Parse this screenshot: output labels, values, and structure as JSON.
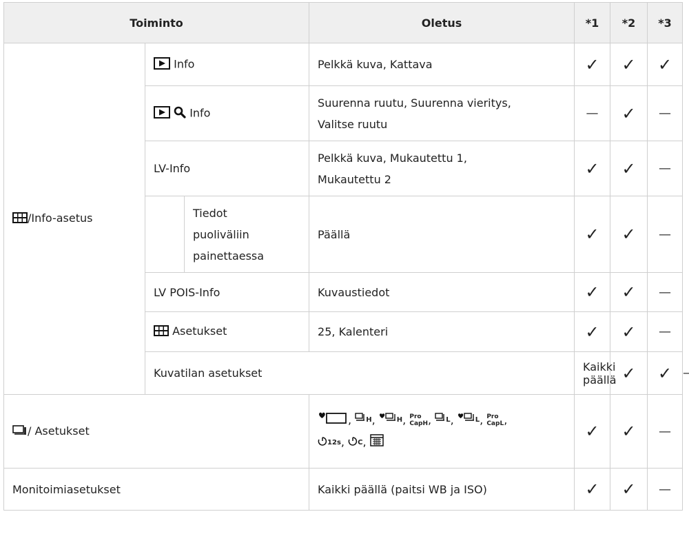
{
  "header": {
    "col_function": "Toiminto",
    "col_default": "Oletus",
    "col1": "*1",
    "col2": "*2",
    "col3": "*3"
  },
  "groups": {
    "info_setting": "/Info-asetus",
    "shooting_mode": "Kuvatilan asetukset",
    "drive_timer": "/ Asetukset",
    "multifunction": "Monitoimiasetukset"
  },
  "rows": {
    "play_info": {
      "label": "Info",
      "default": "Pelkkä kuva, Kattava"
    },
    "zoom_info": {
      "label": "Info",
      "default_1": "Suurenna ruutu, Suurenna vieritys,",
      "default_2": "Valitse ruutu"
    },
    "lv_info": {
      "label": "LV-Info",
      "default_1": "Pelkkä kuva, Mukautettu 1,",
      "default_2": "Mukautettu 2"
    },
    "half_press": {
      "label_1": "Tiedot",
      "label_2": "puoliväliin",
      "label_3": "painettaessa",
      "default": "Päällä"
    },
    "lv_off": {
      "label": "LV POIS-Info",
      "default": "Kuvaustiedot"
    },
    "index": {
      "label": "Asetukset",
      "default": "25, Kalenteri"
    },
    "shooting_mode": {
      "default": "Kaikki päällä"
    },
    "drive_timer": {
      "sym_h": "H",
      "sym_l": "L",
      "sym_pro": "Pro",
      "sym_cap": "Cap",
      "sym_12s": "12s",
      "sym_c": "C",
      "sep": ","
    },
    "multifunction": {
      "default": "Kaikki päällä (paitsi WB ja ISO)"
    }
  },
  "marks": {
    "check": "✓",
    "dash": "—"
  }
}
